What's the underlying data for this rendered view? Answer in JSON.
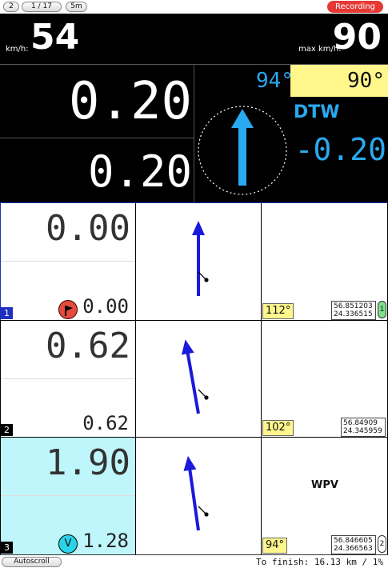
{
  "topbar": {
    "page_button": "2",
    "counter_button": "1 / 17",
    "time_button": "5m",
    "recording_label": "Recording"
  },
  "speed": {
    "unit_label": "km/h:",
    "value": "54",
    "max_unit_label": "max km/h:",
    "max_value": "90"
  },
  "vmg": {
    "value_top": "0.20",
    "value_bottom": "0.20"
  },
  "compass": {
    "heading_value": "94°",
    "target_heading": "90°",
    "dtw_label": "DTW",
    "dtw_value": "-0.20",
    "arrow_bearing_deg": 0
  },
  "rows": [
    {
      "index": "1",
      "value_big": "0.00",
      "value_small": "0.00",
      "heading": "112°",
      "lat": "56.851203",
      "lon": "24.336515",
      "side_knob": "1",
      "wpv_label": "",
      "arrow_tilt_deg": 0
    },
    {
      "index": "2",
      "value_big": "0.62",
      "value_small": "0.62",
      "heading": "102°",
      "lat": "56.84909",
      "lon": "24.345959",
      "side_knob": "",
      "wpv_label": "",
      "arrow_tilt_deg": -10
    },
    {
      "index": "3",
      "value_big": "1.90",
      "value_small": "1.28",
      "heading": "94°",
      "lat": "56.846605",
      "lon": "24.366563",
      "side_knob": "2",
      "wpv_label": "WPV",
      "small_badge": "V",
      "arrow_tilt_deg": -8
    }
  ],
  "bottombar": {
    "autoscroll_label": "Autoscroll",
    "finish_text": "To finish: 16.13 km / 1%"
  },
  "colors": {
    "accent_blue": "#29a9f0",
    "arrow_blue": "#1a1adb",
    "heading_yellow": "#fff68c",
    "recording_red": "#e53935",
    "row_highlight": "#bff6fb",
    "row_index_blue": "#1f2fbf"
  }
}
